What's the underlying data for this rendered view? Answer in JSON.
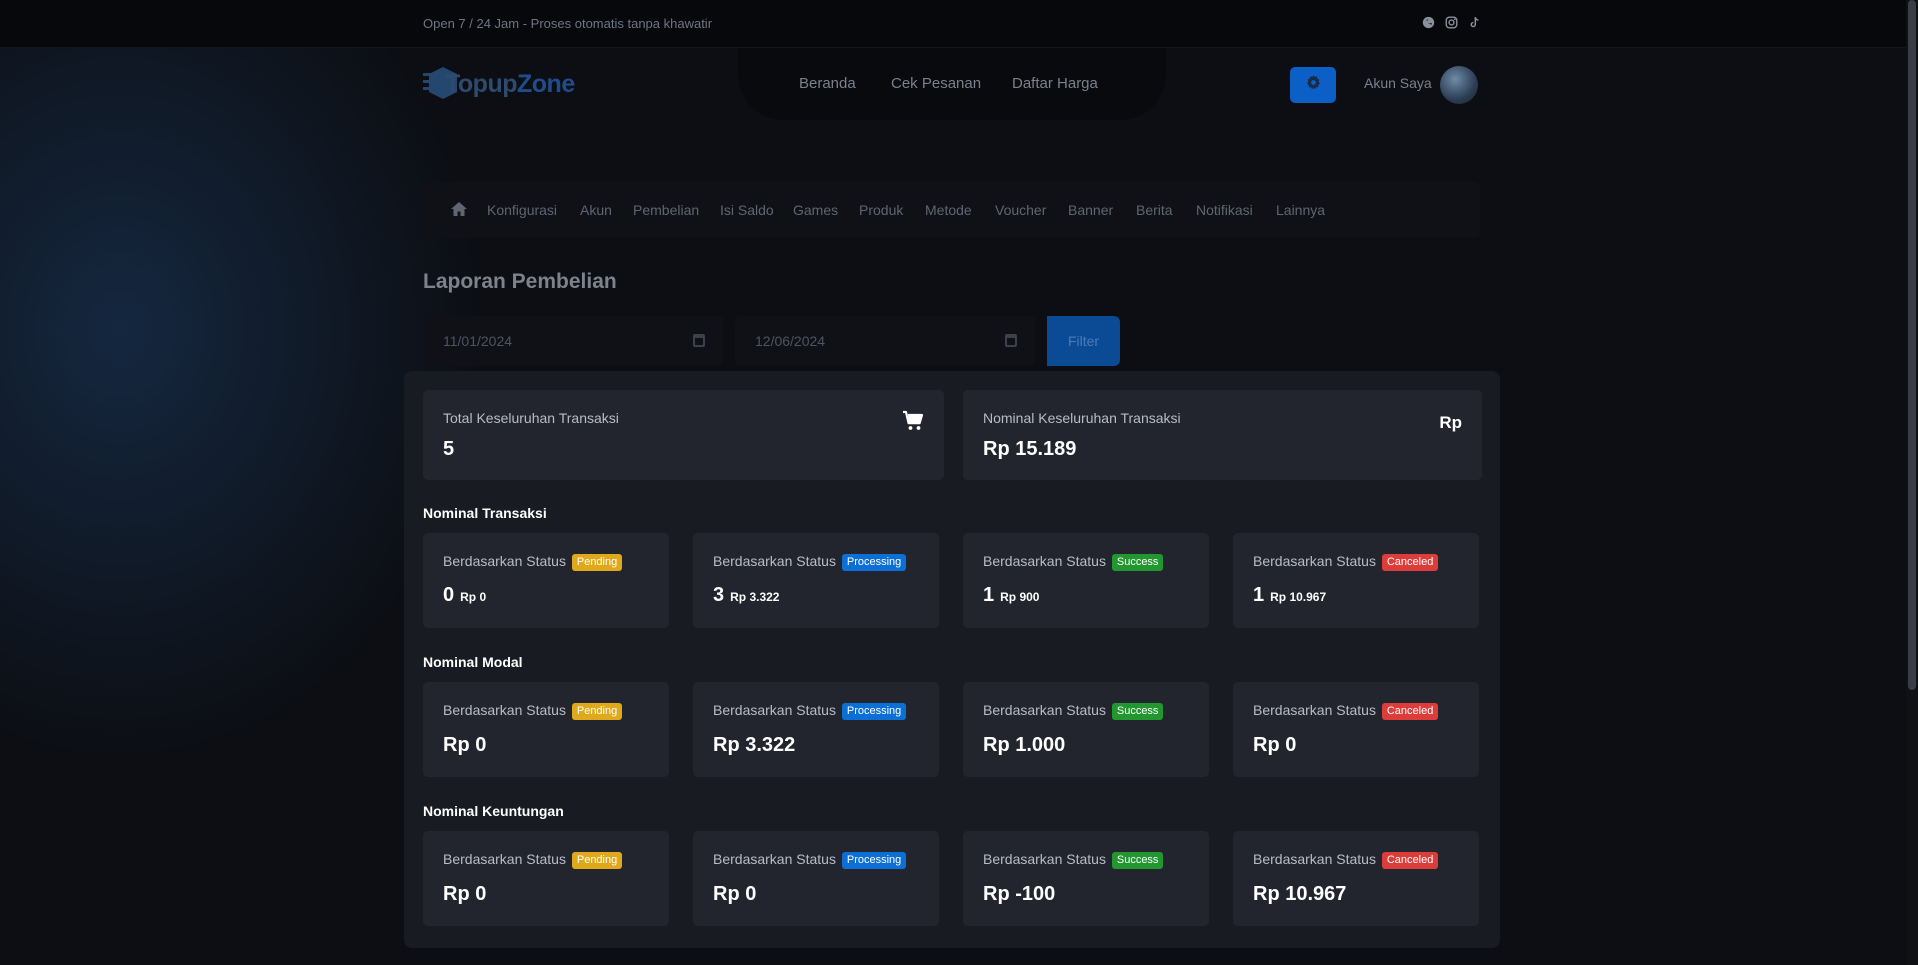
{
  "topbar": {
    "tagline": "Open 7 / 24 Jam - Proses otomatis tanpa khawatir",
    "social_icons": [
      "whatsapp-icon",
      "instagram-icon",
      "tiktok-icon"
    ]
  },
  "header": {
    "logo_part1": "Topup",
    "logo_part2": "Zone",
    "nav": [
      "Beranda",
      "Cek Pesanan",
      "Daftar Harga"
    ],
    "account_label": "Akun Saya"
  },
  "menu": {
    "items": [
      "Konfigurasi",
      "Akun",
      "Pembelian",
      "Isi Saldo",
      "Games",
      "Produk",
      "Metode",
      "Voucher",
      "Banner",
      "Berita",
      "Notifikasi",
      "Lainnya"
    ]
  },
  "page": {
    "title": "Laporan Pembelian",
    "date_from": "11/01/2024",
    "date_to": "12/06/2024",
    "filter_label": "Filter"
  },
  "summary": {
    "total_label": "Total Keseluruhan Transaksi",
    "total_value": "5",
    "nominal_label": "Nominal Keseluruhan Transaksi",
    "nominal_value": "Rp 15.189",
    "nominal_icon_text": "Rp"
  },
  "status_prefix": "Berdasarkan Status",
  "statuses": [
    "Pending",
    "Processing",
    "Success",
    "Canceled"
  ],
  "nominal_transaksi": {
    "title": "Nominal Transaksi",
    "cards": [
      {
        "count": "0",
        "amount": "Rp 0"
      },
      {
        "count": "3",
        "amount": "Rp 3.322"
      },
      {
        "count": "1",
        "amount": "Rp 900"
      },
      {
        "count": "1",
        "amount": "Rp 10.967"
      }
    ]
  },
  "nominal_modal": {
    "title": "Nominal Modal",
    "values": [
      "Rp 0",
      "Rp 3.322",
      "Rp 1.000",
      "Rp 0"
    ]
  },
  "nominal_keuntungan": {
    "title": "Nominal Keuntungan",
    "values": [
      "Rp 0",
      "Rp 0",
      "Rp -100",
      "Rp 10.967"
    ]
  },
  "colors": {
    "pending": "#e0a81b",
    "processing": "#0b6fd6",
    "success": "#22962f",
    "canceled": "#dd3d3a",
    "primary": "#0b5fc6"
  }
}
